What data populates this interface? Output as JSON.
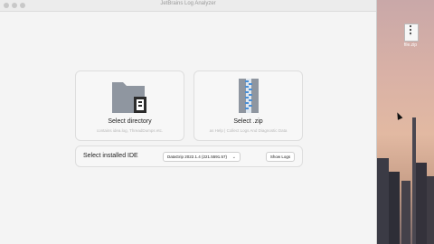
{
  "window": {
    "title": "JetBrains Log Analyzer"
  },
  "desktop": {
    "file_label": "file.zip"
  },
  "cards": {
    "directory": {
      "title": "Select directory",
      "subtitle": "contains idea.log, ThreadDumps etc."
    },
    "zip": {
      "title": "Select .zip",
      "subtitle": "as Help | Collect Logs And Diagnostic Data"
    }
  },
  "ide": {
    "label": "Select installed IDE",
    "selected": "DataGrip 2022.1.4 (221.5591.57)",
    "show_logs": "Show Logs"
  }
}
